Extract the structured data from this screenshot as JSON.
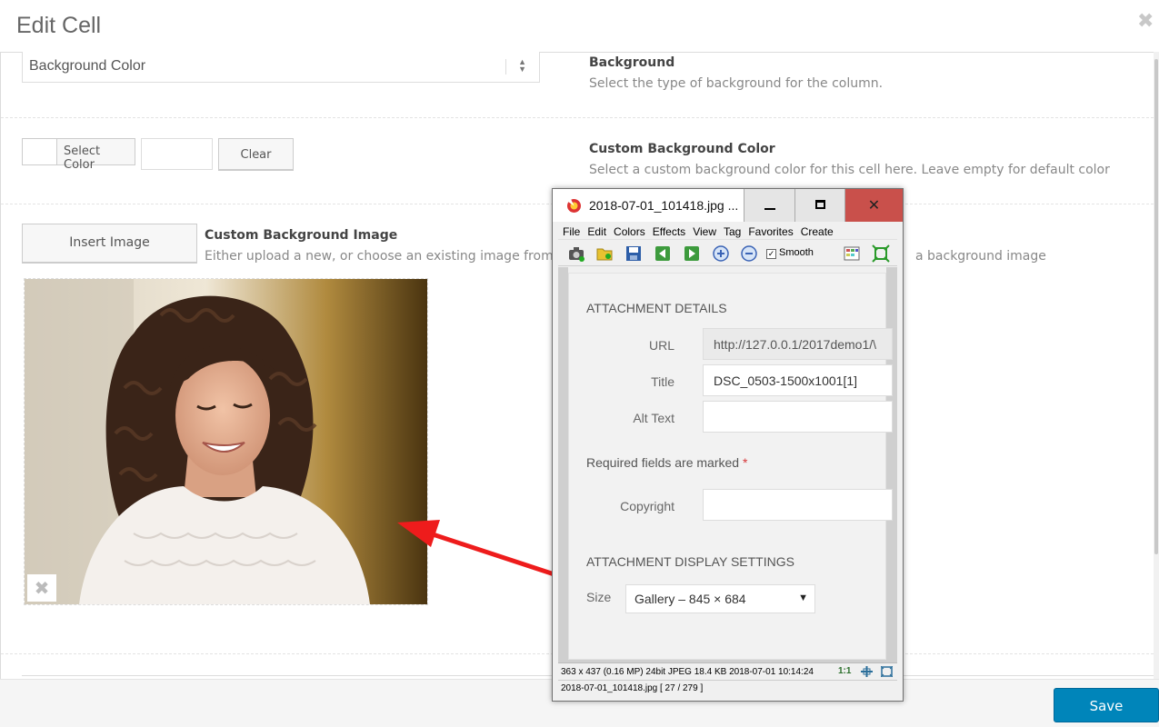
{
  "modal": {
    "title": "Edit Cell",
    "close_icon": "close-icon",
    "save_label": "Save"
  },
  "background": {
    "select_value": "Background Color",
    "title": "Background",
    "description": "Select the type of background for the column."
  },
  "custom_color": {
    "select_label": "Select Color",
    "input_value": "",
    "clear_label": "Clear",
    "title": "Custom Background Color",
    "description": "Select a custom background color for this cell here. Leave empty for default color"
  },
  "custom_image": {
    "insert_label": "Insert Image",
    "title": "Custom Background Image",
    "description_left": "Either upload a new, or choose an existing image from y",
    "description_right": "a background image",
    "remove_icon": "close-icon"
  },
  "viewer": {
    "title": "2018-07-01_101418.jpg  ...",
    "app_icon": "irfanview-icon",
    "menu": [
      "File",
      "Edit",
      "Colors",
      "Effects",
      "View",
      "Tag",
      "Favorites",
      "Create"
    ],
    "smooth_label": "Smooth",
    "smooth_checked": true,
    "status_line1": "363 x 437 (0.16 MP)  24bit  JPEG   18.4 KB   2018-07-01 10:14:24",
    "status_zoom": "1:1",
    "status_line2": "2018-07-01_101418.jpg [ 27 / 279 ]"
  },
  "attachment": {
    "details_heading": "ATTACHMENT DETAILS",
    "url_label": "URL",
    "url_value": "http://127.0.0.1/2017demo1/\\",
    "title_label": "Title",
    "title_value": "DSC_0503-1500x1001[1]",
    "alt_label": "Alt Text",
    "alt_value": "",
    "required_text": "Required fields are marked",
    "required_star": "*",
    "copyright_label": "Copyright",
    "copyright_value": "",
    "display_heading": "ATTACHMENT DISPLAY SETTINGS",
    "size_label": "Size",
    "size_value": "Gallery – 845 × 684"
  },
  "colors": {
    "save_button": "#0085ba",
    "close_button": "#c9504b",
    "annotation_arrow": "#ee1c1c"
  }
}
